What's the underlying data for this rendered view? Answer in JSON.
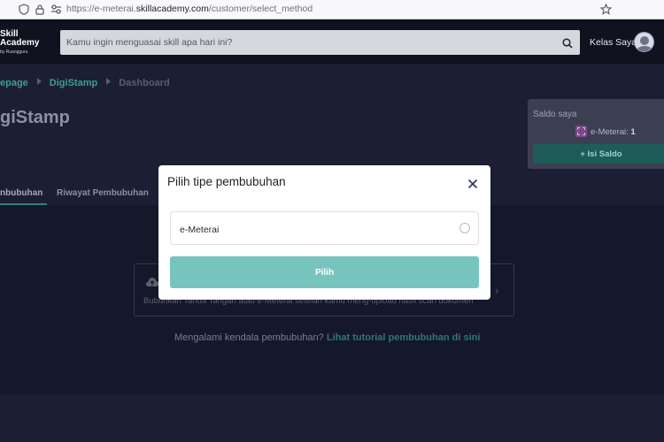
{
  "browser": {
    "url_prefix": "https://e-meterai.",
    "url_domain": "skillacademy.com",
    "url_path": "/customer/select_method"
  },
  "header": {
    "logo_line1": "Skill",
    "logo_line2": "Academy",
    "logo_sub": "by Ruangguru",
    "search_placeholder": "Kamu ingin menguasai skill apa hari ini?",
    "kelas_label": "Kelas Saya"
  },
  "breadcrumb": {
    "items": [
      "epage",
      "DigiStamp",
      "Dashboard"
    ]
  },
  "page": {
    "title": "giStamp"
  },
  "saldo": {
    "label": "Saldo saya",
    "item_name": "e-Meterai:",
    "item_count": "1",
    "button": "+ Isi Saldo"
  },
  "tabs": [
    "nbubuhan",
    "Riwayat Pembubuhan"
  ],
  "upload_card": {
    "description": "Bubuhkan Tanda Tangan atau e-Meterai setelah kamu meng-upload hasil scan dokumen"
  },
  "help": {
    "text": "Mengalami kendala pembubuhan?",
    "link": "Lihat tutorial pembubuhan di sini"
  },
  "modal": {
    "title": "Pilih tipe pembubuhan",
    "option_label": "e-Meterai",
    "option_selected": false,
    "submit": "Pilih"
  },
  "colors": {
    "accent": "#76c4bd",
    "header_bg": "#10121f",
    "page_bg": "#1c1f33",
    "link": "#3c9e98"
  },
  "icons": [
    "shield-icon",
    "lock-icon",
    "permissions-icon",
    "star-icon",
    "search-icon",
    "stamp-icon",
    "cloud-upload-icon",
    "chevron-right-icon",
    "close-icon"
  ]
}
